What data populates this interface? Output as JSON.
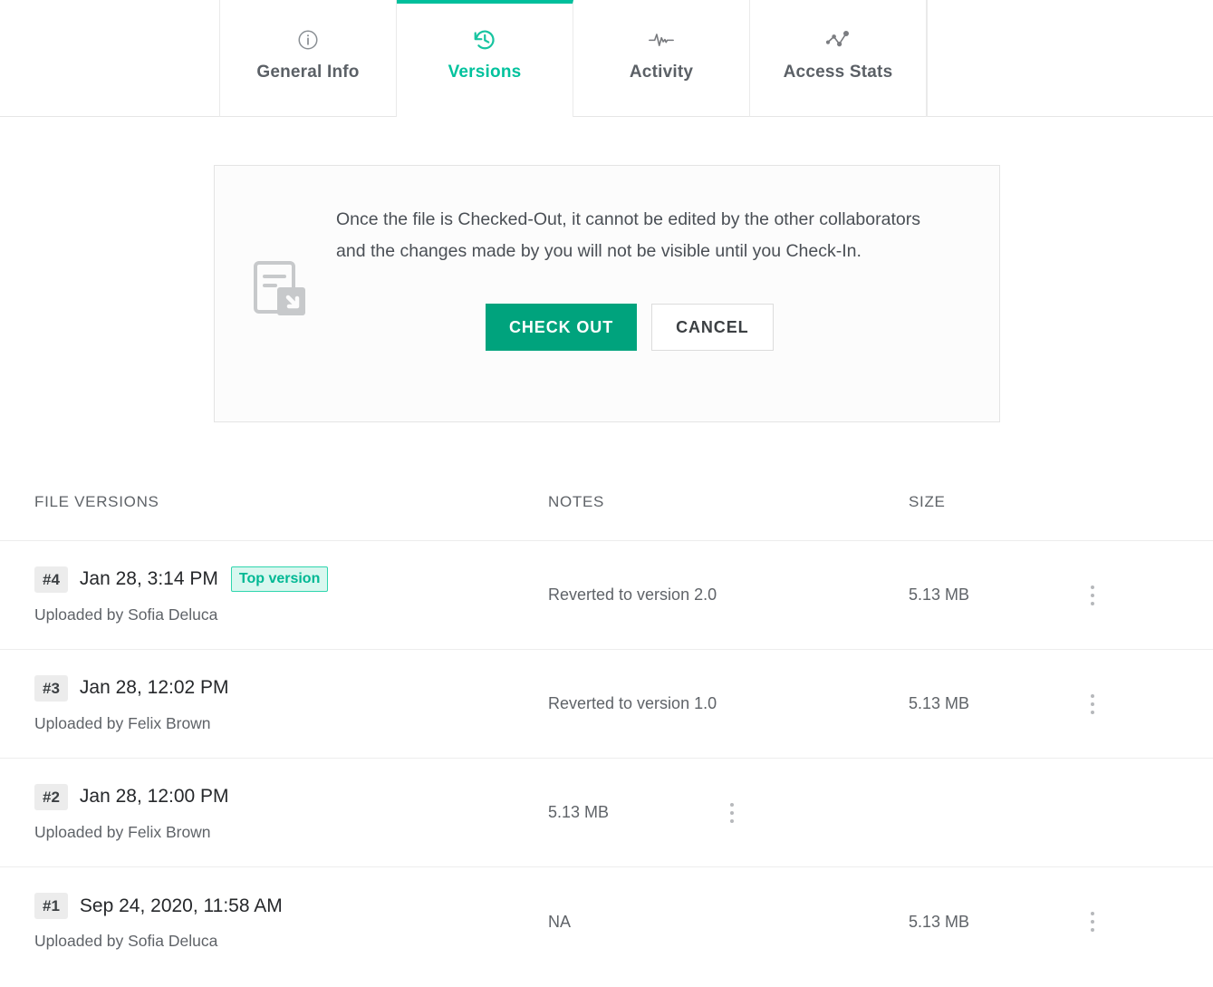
{
  "tabs": [
    {
      "label": "General Info",
      "icon": "info-circle-icon",
      "active": false
    },
    {
      "label": "Versions",
      "icon": "history-restore-icon",
      "active": true
    },
    {
      "label": "Activity",
      "icon": "pulse-activity-icon",
      "active": false
    },
    {
      "label": "Access Stats",
      "icon": "scatter-chart-icon",
      "active": false
    }
  ],
  "checkout_panel": {
    "icon": "document-check-out-icon",
    "message": "Once the file is Checked-Out, it cannot be edited by the other collaborators and the changes made by you will not be visible until you Check-In.",
    "primary_button": "CHECK OUT",
    "secondary_button": "CANCEL"
  },
  "table": {
    "headers": {
      "versions": "FILE VERSIONS",
      "notes": "NOTES",
      "size": "SIZE"
    },
    "rows": [
      {
        "number": "#4",
        "date": "Jan 28, 3:14 PM",
        "badge": "Top version",
        "uploaded_by": "Uploaded by Sofia Deluca",
        "notes": "Reverted to version 2.0",
        "size": "5.13 MB",
        "menu_icon": "more-vertical-icon"
      },
      {
        "number": "#3",
        "date": "Jan 28, 12:02 PM",
        "badge": "",
        "uploaded_by": "Uploaded by Felix Brown",
        "notes": "Reverted to version 1.0",
        "size": "5.13 MB",
        "menu_icon": "more-vertical-icon"
      },
      {
        "number": "#2",
        "date": "Jan 28, 12:00 PM",
        "badge": "",
        "uploaded_by": "Uploaded by Felix Brown",
        "notes": "",
        "size": "5.13 MB",
        "menu_icon": "more-vertical-icon"
      },
      {
        "number": "#1",
        "date": "Sep 24, 2020, 11:58 AM",
        "badge": "",
        "uploaded_by": "Uploaded by Sofia Deluca",
        "notes": "NA",
        "size": "5.13 MB",
        "menu_icon": "more-vertical-icon"
      }
    ]
  },
  "colors": {
    "accent_teal": "#00bf9c",
    "primary_green": "#00a37d",
    "badge_bg": "#d9f7ef",
    "badge_border": "#2fd6ae",
    "text_primary": "#26282b",
    "text_secondary": "#5f6368",
    "divider": "#ededed"
  }
}
